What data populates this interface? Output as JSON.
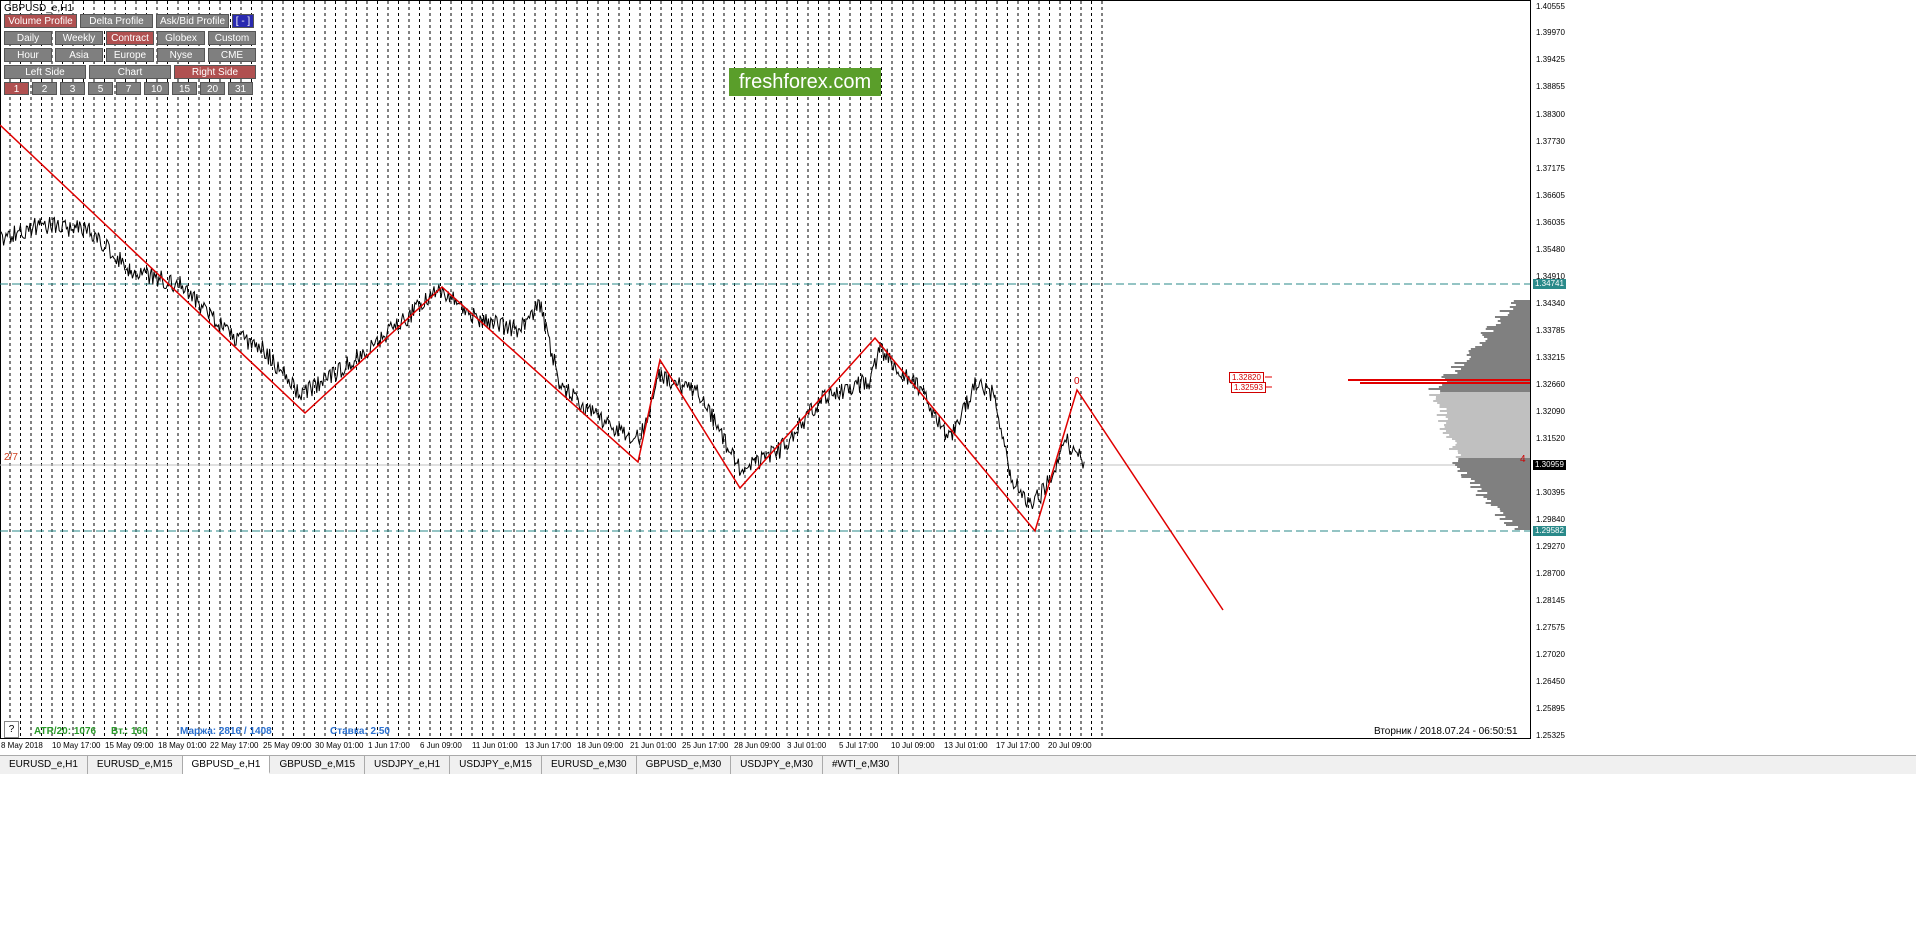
{
  "window": {
    "title": "GBPUSD_e,H1"
  },
  "panel": {
    "row1": [
      {
        "label": "Volume Profile",
        "active": true
      },
      {
        "label": "Delta Profile",
        "active": false
      },
      {
        "label": "Ask/Bid Profile",
        "active": false
      },
      {
        "label": "[ - ]",
        "active": false
      }
    ],
    "row2": [
      {
        "label": "Daily",
        "active": false
      },
      {
        "label": "Weekly",
        "active": false
      },
      {
        "label": "Contract",
        "active": true
      },
      {
        "label": "Globex",
        "active": false
      },
      {
        "label": "Custom",
        "active": false
      }
    ],
    "row3": [
      {
        "label": "Hour",
        "active": false
      },
      {
        "label": "Asia",
        "active": false
      },
      {
        "label": "Europe",
        "active": false
      },
      {
        "label": "Nyse",
        "active": false
      },
      {
        "label": "CME",
        "active": false
      }
    ],
    "row4": [
      {
        "label": "Left Side",
        "active": false
      },
      {
        "label": "Chart",
        "active": false
      },
      {
        "label": "Right Side",
        "active": true
      }
    ],
    "row5": [
      {
        "label": "1",
        "active": true
      },
      {
        "label": "2",
        "active": false
      },
      {
        "label": "3",
        "active": false
      },
      {
        "label": "5",
        "active": false
      },
      {
        "label": "7",
        "active": false
      },
      {
        "label": "10",
        "active": false
      },
      {
        "label": "15",
        "active": false
      },
      {
        "label": "20",
        "active": false
      },
      {
        "label": "31",
        "active": false
      }
    ]
  },
  "logo": {
    "text": "freshforex.com"
  },
  "price_axis": {
    "labels": [
      "1.40555",
      "1.39970",
      "1.39425",
      "1.38855",
      "1.38300",
      "1.37730",
      "1.37175",
      "1.36605",
      "1.36035",
      "1.35480",
      "1.34910",
      "1.34340",
      "1.33785",
      "1.33215",
      "1.32660",
      "1.32090",
      "1.31520",
      "1.30395",
      "1.29840",
      "1.29270",
      "1.28700",
      "1.28145",
      "1.27575",
      "1.27020",
      "1.26450",
      "1.25895",
      "1.25325"
    ],
    "tags": {
      "upper_level": "1.34741",
      "current": "1.30959",
      "lower_level": "1.29582"
    }
  },
  "time_axis": {
    "labels": [
      "8 May 2018",
      "10 May 17:00",
      "15 May 09:00",
      "18 May 01:00",
      "22 May 17:00",
      "25 May 09:00",
      "30 May 01:00",
      "1 Jun 17:00",
      "6 Jun 09:00",
      "11 Jun 01:00",
      "13 Jun 17:00",
      "18 Jun 09:00",
      "21 Jun 01:00",
      "25 Jun 17:00",
      "28 Jun 09:00",
      "3 Jul 01:00",
      "5 Jul 17:00",
      "10 Jul 09:00",
      "13 Jul 01:00",
      "17 Jul 17:00",
      "20 Jul 09:00"
    ]
  },
  "info_bar": {
    "atr": "ATR/20: 1076",
    "vol": "Вт.: 160",
    "margin": "Маржа: 2816 / 1408",
    "rate": "Ставка: 2.50",
    "datetime": "Вторник  /  2018.07.24  -  06:50:51",
    "help": "?"
  },
  "annotations": {
    "ratio": "2/7",
    "wave_label": "0",
    "right_marker": "4",
    "vol_box_1": "1.32820",
    "vol_box_2": "1.32593"
  },
  "tabs": [
    {
      "label": "EURUSD_e,H1",
      "active": false
    },
    {
      "label": "EURUSD_e,M15",
      "active": false
    },
    {
      "label": "GBPUSD_e,H1",
      "active": true
    },
    {
      "label": "GBPUSD_e,M15",
      "active": false
    },
    {
      "label": "USDJPY_e,H1",
      "active": false
    },
    {
      "label": "USDJPY_e,M15",
      "active": false
    },
    {
      "label": "EURUSD_e,M30",
      "active": false
    },
    {
      "label": "GBPUSD_e,M30",
      "active": false
    },
    {
      "label": "USDJPY_e,M30",
      "active": false
    },
    {
      "label": "#WTI_e,M30",
      "active": false
    }
  ],
  "colors": {
    "zigzag": "#e00000",
    "level_line": "#2a8a8a",
    "volume_profile": "#808080",
    "poc": "#e00000"
  }
}
